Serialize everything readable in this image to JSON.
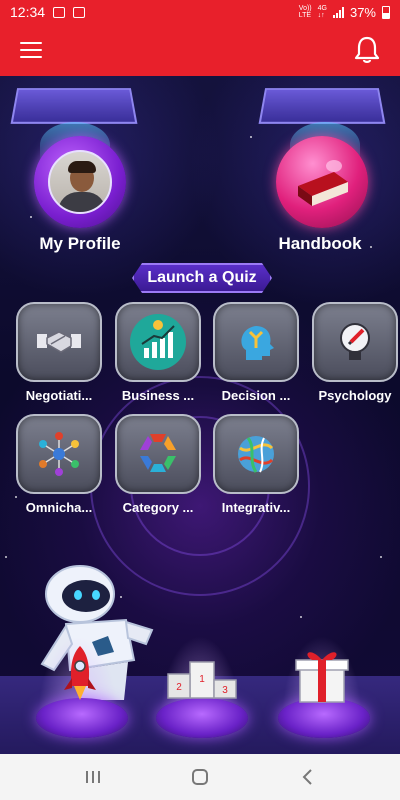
{
  "status_bar": {
    "time": "12:34",
    "net_top": "Vo))",
    "net_bottom": "LTE",
    "net_type_top": "4G",
    "net_type_bottom": "↓↑",
    "battery": "37%"
  },
  "app_bar": {
    "menu_icon": "hamburger-icon",
    "notification_icon": "bell-icon"
  },
  "main_buttons": {
    "profile": {
      "label": "My Profile",
      "icon": "avatar"
    },
    "handbook": {
      "label": "Handbook",
      "icon": "book-icon"
    }
  },
  "quiz_section": {
    "title": "Launch a Quiz",
    "tiles": [
      {
        "label": "Negotiati...",
        "icon": "handshake-icon"
      },
      {
        "label": "Business ...",
        "icon": "growth-chart-icon"
      },
      {
        "label": "Decision ...",
        "icon": "head-arrows-icon"
      },
      {
        "label": "Psychology",
        "icon": "lightbulb-pencil-icon"
      },
      {
        "label": "Omnicha...",
        "icon": "network-people-icon"
      },
      {
        "label": "Category ...",
        "icon": "hexagon-cycle-icon"
      },
      {
        "label": "Integrativ...",
        "icon": "yarn-ball-icon"
      }
    ]
  },
  "pedestals": [
    {
      "icon": "rocket-icon"
    },
    {
      "icon": "podium-icon",
      "podium_numbers": [
        "2",
        "1",
        "3"
      ]
    },
    {
      "icon": "gift-icon"
    }
  ],
  "colors": {
    "primary": "#e8202b",
    "accent_purple": "#7a1fd0",
    "accent_pink": "#e0207c"
  },
  "nav_bar": {
    "recent_icon": "recent-apps-icon",
    "home_icon": "home-icon",
    "back_icon": "back-icon"
  }
}
